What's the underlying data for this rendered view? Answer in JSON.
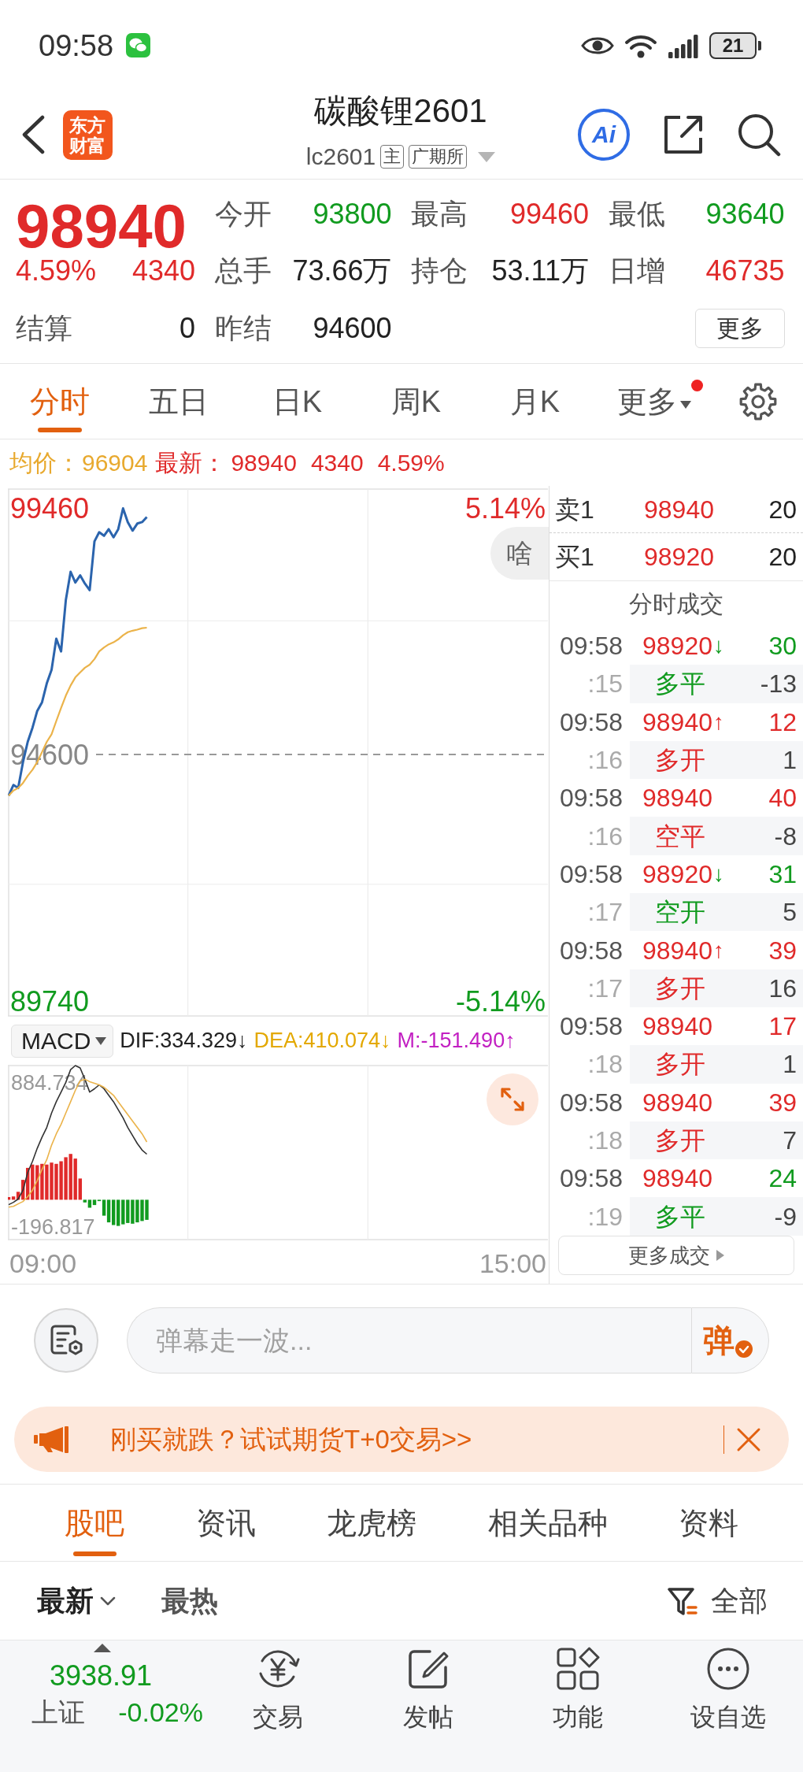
{
  "status_bar": {
    "time": "09:58",
    "battery": "21"
  },
  "header": {
    "logo": "东方财富",
    "title": "碳酸锂2601",
    "code": "lc2601",
    "tags": [
      "主",
      "广期所"
    ],
    "ai": "Ai"
  },
  "quote": {
    "color": "#e02a2a",
    "price": "98940",
    "change_pct": "4.59%",
    "change": "4340",
    "fields": [
      {
        "label": "今开",
        "value": "93800",
        "color": "#119b1f"
      },
      {
        "label": "最高",
        "value": "99460",
        "color": "#e02a2a"
      },
      {
        "label": "最低",
        "value": "93640",
        "color": "#119b1f"
      },
      {
        "label": "总手",
        "value": "73.66万",
        "color": "#222222"
      },
      {
        "label": "持仓",
        "value": "53.11万",
        "color": "#222222"
      },
      {
        "label": "日增",
        "value": "46735",
        "color": "#e02a2a"
      },
      {
        "label": "结算",
        "value": "0",
        "color": "#222222"
      },
      {
        "label": "昨结",
        "value": "94600",
        "color": "#222222"
      }
    ],
    "more": "更多"
  },
  "chart_tabs": [
    {
      "label": "分时",
      "selected": true,
      "dot": false,
      "dropdown": false
    },
    {
      "label": "五日",
      "selected": false,
      "dot": false,
      "dropdown": false
    },
    {
      "label": "日K",
      "selected": false,
      "dot": false,
      "dropdown": false
    },
    {
      "label": "周K",
      "selected": false,
      "dot": false,
      "dropdown": false
    },
    {
      "label": "月K",
      "selected": false,
      "dot": false,
      "dropdown": false
    },
    {
      "label": "更多",
      "selected": false,
      "dot": true,
      "dropdown": true
    }
  ],
  "legend": {
    "avg_label": "均价：",
    "avg": "96904",
    "last_label": "最新：",
    "last": "98940",
    "change": "4340",
    "change_pct": "4.59%"
  },
  "price_chart": {
    "chart_data": {
      "type": "line",
      "categories": [
        null,
        null,
        null,
        null,
        null,
        null,
        null,
        null,
        null,
        null,
        null,
        null,
        null,
        null,
        null,
        null,
        null,
        null,
        null,
        null,
        null,
        null,
        null,
        null,
        null,
        null,
        null,
        null,
        null,
        null,
        null,
        null,
        null,
        null,
        null,
        null,
        null,
        null,
        null,
        null,
        null,
        null,
        null,
        null,
        null,
        null,
        null,
        null,
        null,
        null,
        null,
        null,
        null,
        null,
        null,
        null,
        null,
        null,
        null,
        null,
        null,
        null,
        null,
        null,
        null,
        null,
        null,
        null,
        null,
        null,
        null,
        null,
        null,
        null,
        null,
        null,
        null,
        null,
        null,
        null,
        null,
        null,
        null,
        null,
        null,
        null,
        null,
        null,
        null,
        null,
        null,
        null,
        null,
        null,
        null,
        null,
        null,
        null,
        null,
        null,
        null,
        null,
        null,
        null,
        null,
        null,
        null,
        null,
        null,
        null,
        null,
        null,
        null
      ],
      "series": [
        {
          "color": "#2b64ad",
          "values": [
            93790,
            94000,
            93940,
            94450,
            94850,
            95130,
            95460,
            95630,
            96000,
            96270,
            96880,
            96630,
            97640,
            98200,
            97990,
            98130,
            97970,
            97840,
            98800,
            98980,
            98910,
            99040,
            98880,
            99040,
            99450,
            99180,
            99010,
            99150,
            99180,
            99280,
            null,
            null,
            null,
            null,
            null,
            null,
            null,
            null,
            null,
            null,
            null,
            null,
            null,
            null,
            null,
            null,
            null,
            null,
            null,
            null,
            null,
            null,
            null,
            null,
            null,
            null,
            null,
            null,
            null,
            null,
            null,
            null,
            null,
            null,
            null,
            null,
            null,
            null,
            null,
            null,
            null,
            null,
            null,
            null,
            null,
            null,
            null,
            null,
            null,
            null,
            null,
            null,
            null,
            null,
            null,
            null,
            null,
            null,
            null,
            null,
            null,
            null,
            null,
            null,
            null,
            null,
            null,
            null,
            null,
            null,
            null,
            null,
            null,
            null,
            null,
            null,
            null,
            null,
            null,
            null,
            null,
            null,
            null
          ]
        },
        {
          "color": "#ebb34a",
          "values": [
            93790,
            93890,
            93940,
            94040,
            94180,
            94300,
            94450,
            94650,
            94850,
            95000,
            95260,
            95520,
            95760,
            95960,
            96120,
            96220,
            96310,
            96370,
            96480,
            96630,
            96710,
            96770,
            96810,
            96870,
            96950,
            97010,
            97040,
            97060,
            97090,
            97100,
            null,
            null,
            null,
            null,
            null,
            null,
            null,
            null,
            null,
            null,
            null,
            null,
            null,
            null,
            null,
            null,
            null,
            null,
            null,
            null,
            null,
            null,
            null,
            null,
            null,
            null,
            null,
            null,
            null,
            null,
            null,
            null,
            null,
            null,
            null,
            null,
            null,
            null,
            null,
            null,
            null,
            null,
            null,
            null,
            null,
            null,
            null,
            null,
            null,
            null,
            null,
            null,
            null,
            null,
            null,
            null,
            null,
            null,
            null,
            null,
            null,
            null,
            null,
            null,
            null,
            null,
            null,
            null,
            null,
            null,
            null,
            null,
            null,
            null,
            null,
            null,
            null,
            null,
            null,
            null,
            null,
            null,
            null
          ]
        }
      ],
      "ylim": [
        89450,
        99830
      ],
      "yticks": [
        {
          "value": 99460,
          "label": "99460"
        },
        {
          "value": 94600,
          "label": "94600"
        },
        {
          "value": 89740,
          "label": "89740"
        }
      ]
    },
    "right_labels": [
      "5.14%",
      "-5.14%"
    ],
    "tip": "啥"
  },
  "order_book": [
    {
      "label": "卖1",
      "price": "98940",
      "volume": "20"
    },
    {
      "label": "买1",
      "price": "98920",
      "volume": "20"
    }
  ],
  "trades": {
    "title": "分时成交",
    "rows": [
      {
        "time": "09:58",
        "second": ":15",
        "price": "98920",
        "arrow": "↓",
        "volume": "30",
        "action": "多平",
        "oi_change": "-13",
        "color": "#119b1f"
      },
      {
        "time": "09:58",
        "second": ":16",
        "price": "98940",
        "arrow": "↑",
        "volume": "12",
        "action": "多开",
        "oi_change": "1",
        "color": "#e02a2a"
      },
      {
        "time": "09:58",
        "second": ":16",
        "price": "98940",
        "volume": "40",
        "action": "空平",
        "oi_change": "-8",
        "color": "#e02a2a"
      },
      {
        "time": "09:58",
        "second": ":17",
        "price": "98920",
        "arrow": "↓",
        "volume": "31",
        "action": "空开",
        "oi_change": "5",
        "color": "#119b1f"
      },
      {
        "time": "09:58",
        "second": ":17",
        "price": "98940",
        "arrow": "↑",
        "volume": "39",
        "action": "多开",
        "oi_change": "16",
        "color": "#e02a2a"
      },
      {
        "time": "09:58",
        "second": ":18",
        "price": "98940",
        "volume": "17",
        "action": "多开",
        "oi_change": "1",
        "color": "#e02a2a"
      },
      {
        "time": "09:58",
        "second": ":18",
        "price": "98940",
        "volume": "39",
        "action": "多开",
        "oi_change": "7",
        "color": "#e02a2a"
      },
      {
        "time": "09:58",
        "second": ":19",
        "price": "98940",
        "volume": "24",
        "action": "多平",
        "oi_change": "-9",
        "color": "#119b1f"
      }
    ],
    "more": "更多成交"
  },
  "macd": {
    "indicator": "MACD",
    "legend": [
      {
        "text": "DIF:334.329↓",
        "color": "#222222"
      },
      {
        "text": "DEA:410.074↓",
        "color": "#e3a800"
      },
      {
        "text": "M:-151.490↑",
        "color": "#c21fc2"
      }
    ],
    "lines": {
      "chart_data": {
        "type": "line",
        "categories": [
          null,
          null,
          null,
          null,
          null,
          null,
          null,
          null,
          null,
          null,
          null,
          null,
          null,
          null,
          null,
          null,
          null,
          null,
          null,
          null,
          null,
          null,
          null,
          null,
          null,
          null,
          null,
          null,
          null,
          null,
          null,
          null,
          null,
          null,
          null,
          null,
          null,
          null,
          null,
          null,
          null,
          null,
          null,
          null,
          null,
          null,
          null,
          null,
          null,
          null,
          null,
          null,
          null,
          null,
          null,
          null,
          null,
          null,
          null,
          null,
          null,
          null,
          null,
          null,
          null,
          null,
          null,
          null,
          null,
          null,
          null,
          null,
          null,
          null,
          null,
          null,
          null,
          null,
          null,
          null,
          null,
          null,
          null,
          null,
          null,
          null,
          null,
          null,
          null,
          null,
          null,
          null,
          null,
          null,
          null,
          null,
          null,
          null,
          null,
          null,
          null,
          null,
          null,
          null,
          null,
          null,
          null,
          null,
          null,
          null,
          null,
          null,
          null
        ],
        "series": [
          {
            "color": "#333333",
            "values": [
              -37,
              -19,
              5,
              72,
              205,
              290,
              387,
              471,
              544,
              653,
              738,
              811,
              883,
              980,
              1010,
              992,
              907,
              811,
              835,
              865,
              835,
              786,
              738,
              677,
              617,
              544,
              483,
              423,
              374,
              343,
              null,
              null,
              null,
              null,
              null,
              null,
              null,
              null,
              null,
              null,
              null,
              null,
              null,
              null,
              null,
              null,
              null,
              null,
              null,
              null,
              null,
              null,
              null,
              null,
              null,
              null,
              null,
              null,
              null,
              null,
              null,
              null,
              null,
              null,
              null,
              null,
              null,
              null,
              null,
              null,
              null,
              null,
              null,
              null,
              null,
              null,
              null,
              null,
              null,
              null,
              null,
              null,
              null,
              null,
              null,
              null,
              null,
              null,
              null,
              null,
              null,
              null,
              null,
              null,
              null,
              null,
              null,
              null,
              null,
              null,
              null,
              null,
              null,
              null,
              null,
              null,
              null,
              null,
              null,
              null,
              null,
              null,
              null
            ]
          },
          {
            "color": "#ebb34a",
            "values": [
              -56,
              -50,
              -31,
              -13,
              23,
              72,
              144,
              229,
              302,
              411,
              496,
              568,
              653,
              738,
              823,
              895,
              907,
              889,
              877,
              865,
              847,
              817,
              786,
              738,
              689,
              641,
              592,
              544,
              496,
              435,
              null,
              null,
              null,
              null,
              null,
              null,
              null,
              null,
              null,
              null,
              null,
              null,
              null,
              null,
              null,
              null,
              null,
              null,
              null,
              null,
              null,
              null,
              null,
              null,
              null,
              null,
              null,
              null,
              null,
              null,
              null,
              null,
              null,
              null,
              null,
              null,
              null,
              null,
              null,
              null,
              null,
              null,
              null,
              null,
              null,
              null,
              null,
              null,
              null,
              null,
              null,
              null,
              null,
              null,
              null,
              null,
              null,
              null,
              null,
              null,
              null,
              null,
              null,
              null,
              null,
              null,
              null,
              null,
              null,
              null,
              null,
              null,
              null,
              null,
              null,
              null,
              null,
              null,
              null,
              null,
              null,
              null,
              null
            ]
          }
        ],
        "ylim": [
          -300,
          1010
        ],
        "yticks": [
          {
            "value": 884.734,
            "label": "884.734"
          },
          {
            "value": -196.817,
            "label": "-196.817"
          }
        ]
      }
    }
  },
  "time_axis": [
    "09:00",
    "15:00"
  ],
  "danmu": {
    "placeholder": "弹幕走一波...",
    "send": "弹"
  },
  "banner": {
    "text": "刚买就跌？试试期货T+0交易>>"
  },
  "section_tabs": [
    {
      "label": "股吧",
      "selected": true
    },
    {
      "label": "资讯",
      "selected": false
    },
    {
      "label": "龙虎榜",
      "selected": false
    },
    {
      "label": "相关品种",
      "selected": false
    },
    {
      "label": "资料",
      "selected": false
    }
  ],
  "sort": {
    "options": [
      {
        "label": "最新",
        "selected": true,
        "dropdown": true
      },
      {
        "label": "最热",
        "selected": false,
        "dropdown": false
      }
    ],
    "filter": "全部"
  },
  "bottom_nav": {
    "index": {
      "value": "3938.91",
      "name": "上证",
      "change": "-0.02%",
      "color": "#119b1f"
    },
    "items": [
      {
        "label": "交易",
        "kind": "exchange"
      },
      {
        "label": "发帖",
        "kind": "post"
      },
      {
        "label": "功能",
        "kind": "apps"
      },
      {
        "label": "设自选",
        "kind": "more"
      }
    ]
  }
}
